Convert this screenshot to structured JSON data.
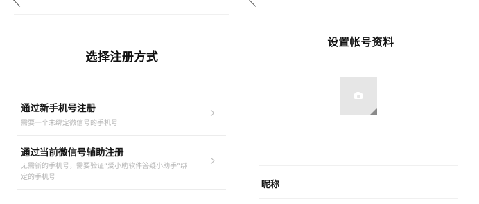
{
  "register_method_screen": {
    "title": "选择注册方式",
    "options": [
      {
        "title": "通过新手机号注册",
        "description": "需要一个未绑定微信号的手机号"
      },
      {
        "title": "通过当前微信号辅助注册",
        "description": "无需新的手机号，需要验证“爱小助软件答疑小助手”绑定的手机号"
      }
    ]
  },
  "profile_setup_screen": {
    "title": "设置帐号资料",
    "avatar": {
      "icon": "camera-icon"
    },
    "fields": [
      {
        "label": "昵称",
        "value": ""
      }
    ]
  },
  "colors": {
    "background": "#ffffff",
    "primary_text": "#161616",
    "secondary_text": "#b4b4b4",
    "divider": "#ececec",
    "avatar_placeholder": "#e6e6e6"
  }
}
